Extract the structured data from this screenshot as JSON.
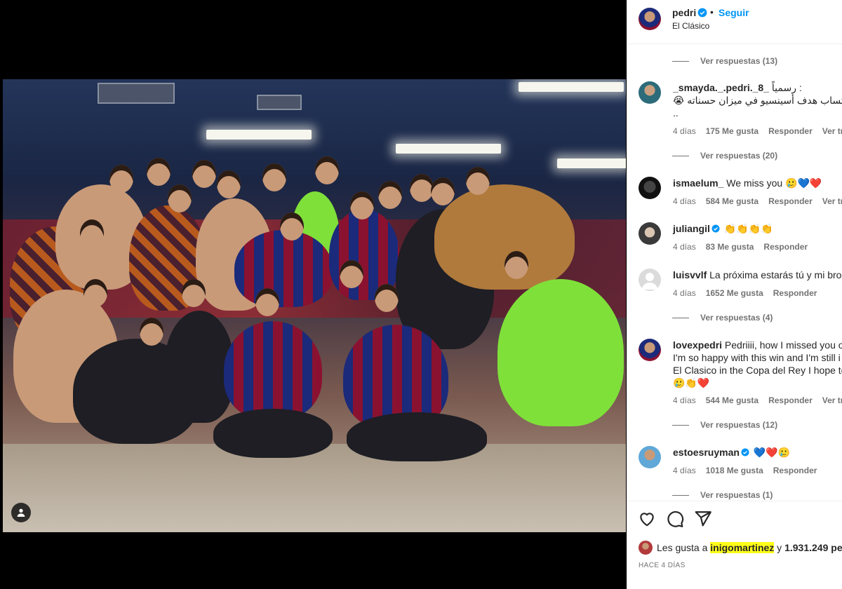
{
  "colors": {
    "accent": "#0095f6",
    "text": "#262626",
    "muted": "#737373",
    "highlight": "#ffff1a",
    "heart": "#e0245e"
  },
  "post": {
    "username": "pedri",
    "separator": "•",
    "follow_label": "Seguir",
    "location": "El Clásico"
  },
  "replies": [
    {
      "label": "Ver respuestas (13)"
    },
    {
      "label": "Ver respuestas (20)"
    },
    {
      "label": "Ver respuestas (4)"
    },
    {
      "label": "Ver respuestas (12)"
    },
    {
      "label": "Ver respuestas (1)"
    }
  ],
  "comments": [
    {
      "username": "_smayda._.pedri._8_",
      "text": "رسمياً :",
      "text2": "😭 إحتساب هدف أسينسيو في ميزان حسناته",
      "text3": "..",
      "age": "4 días",
      "likes": "175 Me gusta",
      "reply": "Responder",
      "translate": "Ver tradu"
    },
    {
      "username": "ismaelum_",
      "text": "We miss you 🥲💙❤️",
      "age": "4 días",
      "likes": "584 Me gusta",
      "reply": "Responder",
      "translate": "Ver trad"
    },
    {
      "username": "juliangil",
      "text": "👏👏👏👏",
      "age": "4 días",
      "likes": "83 Me gusta",
      "reply": "Responder"
    },
    {
      "username": "luisvvlf",
      "text": "La próxima estarás tú y mi bro e",
      "age": "4 días",
      "likes": "1652 Me gusta",
      "reply": "Responder"
    },
    {
      "username": "lovexpedri",
      "text": "Pedriiii, how I missed you on",
      "text2": "I'm so happy with this win and I'm still i",
      "text3": "El Clasico in the Copa del Rey I hope to",
      "text4": "🥲👏❤️",
      "age": "4 días",
      "likes": "544 Me gusta",
      "reply": "Responder",
      "translate": "Ver trad"
    },
    {
      "username": "estoesruyman",
      "text": "💙❤️🥲",
      "age": "4 días",
      "likes": "1018 Me gusta",
      "reply": "Responder"
    }
  ],
  "likes": {
    "prefix": "Les gusta a ",
    "highlight_user": "inigomartinez",
    "suffix": " y ",
    "count": "1.931.249",
    "tail": " perso"
  },
  "time_ago": "HACE 4 DÍAS",
  "icons": {
    "like": "heart-icon",
    "comment": "comment-icon",
    "share": "share-icon",
    "tag": "user-tag-icon",
    "verified": "verified-badge-icon"
  }
}
